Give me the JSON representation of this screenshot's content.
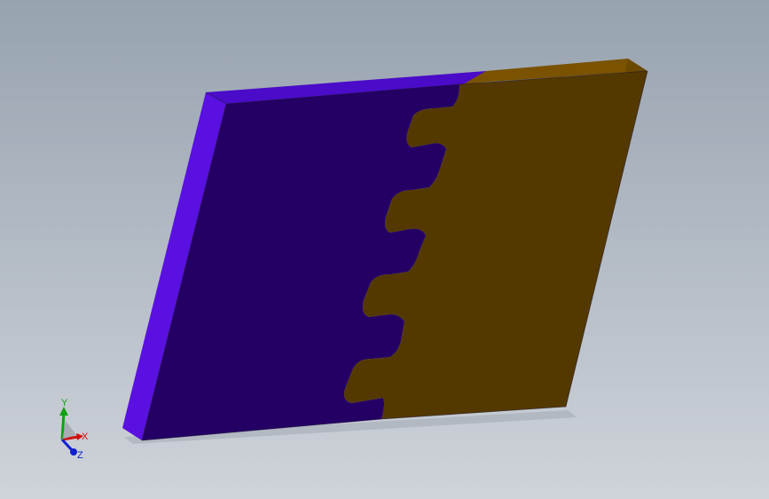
{
  "scene": {
    "background_top": "#97a3b0",
    "background_bottom": "#cfd3da",
    "parts": [
      {
        "name": "left-plate",
        "face_color": "#240064",
        "edge_color": "#5a10e0",
        "top_color": "#4a0cc8"
      },
      {
        "name": "right-plate",
        "face_color": "#533900",
        "top_color": "#7a5200",
        "side_color": "#6b4a00"
      }
    ]
  },
  "triad": {
    "x_label": "X",
    "y_label": "Y",
    "z_label": "Z",
    "x_color": "#d01010",
    "y_color": "#10a010",
    "z_color": "#1020d0"
  }
}
